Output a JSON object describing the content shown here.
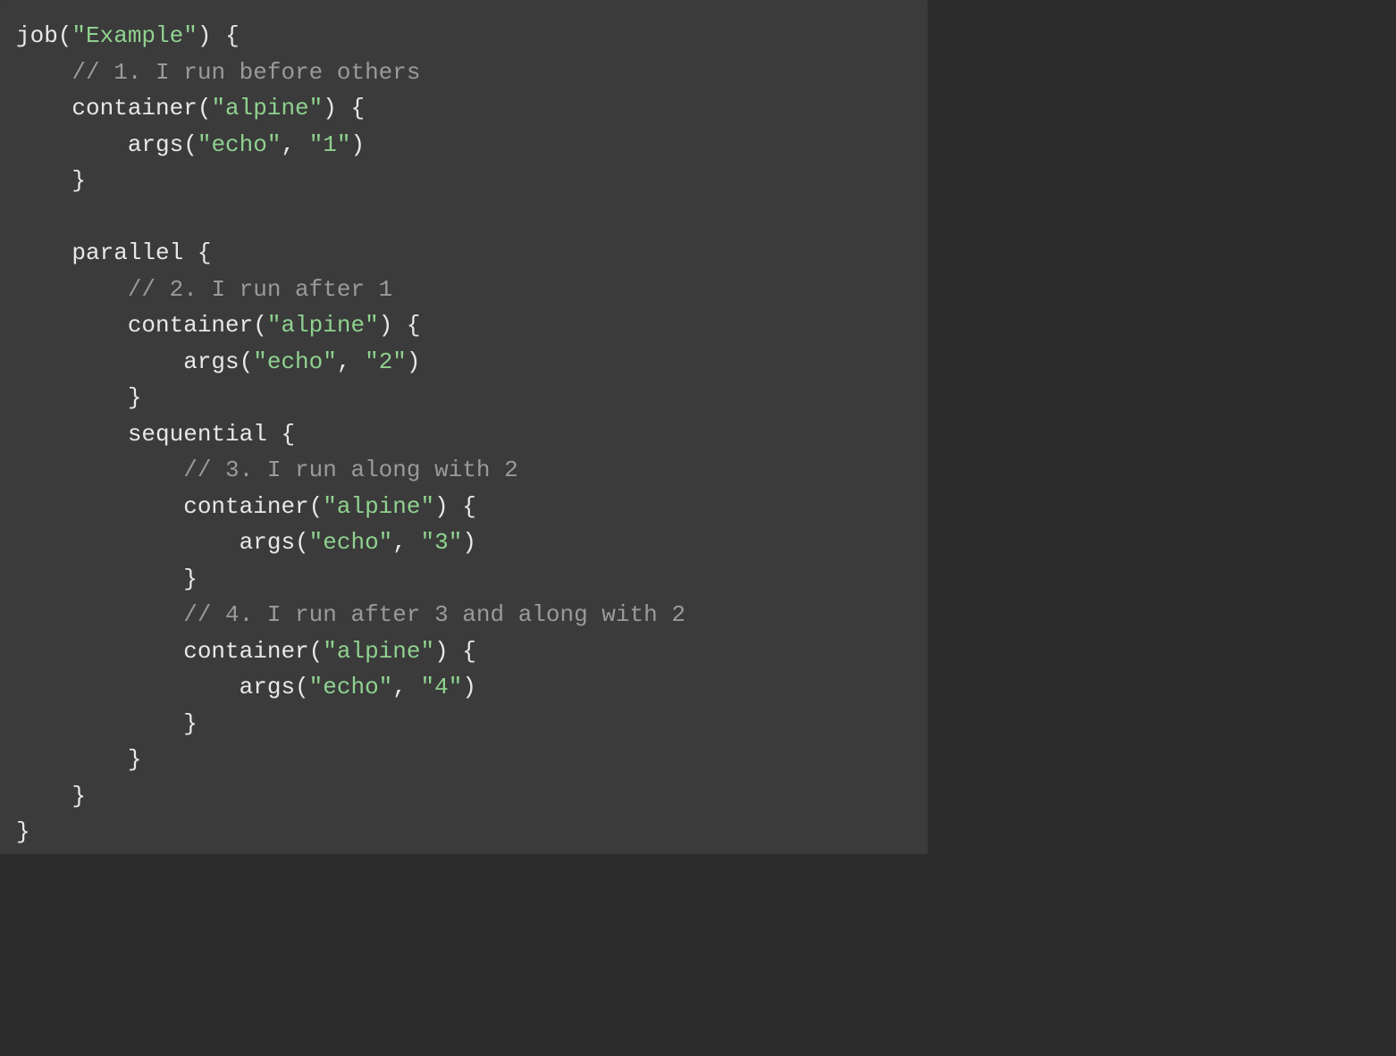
{
  "code": {
    "tokens": [
      {
        "t": "kw",
        "v": "job("
      },
      {
        "t": "str",
        "v": "\"Example\""
      },
      {
        "t": "kw",
        "v": ") {"
      },
      {
        "t": "nl"
      },
      {
        "t": "kw",
        "v": "    "
      },
      {
        "t": "com",
        "v": "// 1. I run before others"
      },
      {
        "t": "nl"
      },
      {
        "t": "kw",
        "v": "    container("
      },
      {
        "t": "str",
        "v": "\"alpine\""
      },
      {
        "t": "kw",
        "v": ") {"
      },
      {
        "t": "nl"
      },
      {
        "t": "kw",
        "v": "        args("
      },
      {
        "t": "str",
        "v": "\"echo\""
      },
      {
        "t": "kw",
        "v": ", "
      },
      {
        "t": "str",
        "v": "\"1\""
      },
      {
        "t": "kw",
        "v": ")"
      },
      {
        "t": "nl"
      },
      {
        "t": "kw",
        "v": "    }"
      },
      {
        "t": "nl"
      },
      {
        "t": "nl"
      },
      {
        "t": "kw",
        "v": "    parallel {"
      },
      {
        "t": "nl"
      },
      {
        "t": "kw",
        "v": "        "
      },
      {
        "t": "com",
        "v": "// 2. I run after 1"
      },
      {
        "t": "nl"
      },
      {
        "t": "kw",
        "v": "        container("
      },
      {
        "t": "str",
        "v": "\"alpine\""
      },
      {
        "t": "kw",
        "v": ") {"
      },
      {
        "t": "nl"
      },
      {
        "t": "kw",
        "v": "            args("
      },
      {
        "t": "str",
        "v": "\"echo\""
      },
      {
        "t": "kw",
        "v": ", "
      },
      {
        "t": "str",
        "v": "\"2\""
      },
      {
        "t": "kw",
        "v": ")"
      },
      {
        "t": "nl"
      },
      {
        "t": "kw",
        "v": "        }"
      },
      {
        "t": "nl"
      },
      {
        "t": "kw",
        "v": "        sequential {"
      },
      {
        "t": "nl"
      },
      {
        "t": "kw",
        "v": "            "
      },
      {
        "t": "com",
        "v": "// 3. I run along with 2"
      },
      {
        "t": "nl"
      },
      {
        "t": "kw",
        "v": "            container("
      },
      {
        "t": "str",
        "v": "\"alpine\""
      },
      {
        "t": "kw",
        "v": ") {"
      },
      {
        "t": "nl"
      },
      {
        "t": "kw",
        "v": "                args("
      },
      {
        "t": "str",
        "v": "\"echo\""
      },
      {
        "t": "kw",
        "v": ", "
      },
      {
        "t": "str",
        "v": "\"3\""
      },
      {
        "t": "kw",
        "v": ")"
      },
      {
        "t": "nl"
      },
      {
        "t": "kw",
        "v": "            }"
      },
      {
        "t": "nl"
      },
      {
        "t": "kw",
        "v": "            "
      },
      {
        "t": "com",
        "v": "// 4. I run after 3 and along with 2"
      },
      {
        "t": "nl"
      },
      {
        "t": "kw",
        "v": "            container("
      },
      {
        "t": "str",
        "v": "\"alpine\""
      },
      {
        "t": "kw",
        "v": ") {"
      },
      {
        "t": "nl"
      },
      {
        "t": "kw",
        "v": "                args("
      },
      {
        "t": "str",
        "v": "\"echo\""
      },
      {
        "t": "kw",
        "v": ", "
      },
      {
        "t": "str",
        "v": "\"4\""
      },
      {
        "t": "kw",
        "v": ")"
      },
      {
        "t": "nl"
      },
      {
        "t": "kw",
        "v": "            }"
      },
      {
        "t": "nl"
      },
      {
        "t": "kw",
        "v": "        }"
      },
      {
        "t": "nl"
      },
      {
        "t": "kw",
        "v": "    }"
      },
      {
        "t": "nl"
      },
      {
        "t": "kw",
        "v": "}"
      }
    ]
  }
}
